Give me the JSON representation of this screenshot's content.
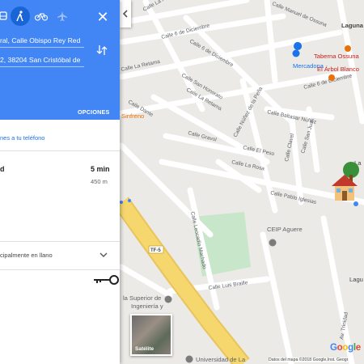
{
  "transport_modes": [
    {
      "name": "transit-mode",
      "icon": "bus-icon"
    },
    {
      "name": "walking-mode",
      "icon": "walk-icon",
      "active": true
    },
    {
      "name": "cycling-mode",
      "icon": "bicycle-icon"
    },
    {
      "name": "flight-mode",
      "icon": "plane-icon"
    }
  ],
  "close_label": "✕",
  "origin": "ral, Calle Obispo Rey Red",
  "destination": "2, 38204 San Cristóbal de",
  "options_label": "OPCIONES",
  "send_to_phone": "nes a tu teléfono",
  "route": {
    "mode_label": "d",
    "time": "5 min",
    "distance": "450 m",
    "description": "cipalmente en llano"
  },
  "map": {
    "streets": [
      "Calle La Higuera",
      "Calle Manuel de Ossuna",
      "Calle 6 de Diciembre",
      "Calle 6 de Diciembre",
      "Calle 6 de Diciembre",
      "Calle La Retama",
      "Calle San Honorato",
      "Calle La Retama",
      "Calle Dante",
      "Calle Baltasar Núñez",
      "Calle Núñez de la Peña",
      "Calle Gravol",
      "Calle El Peso",
      "Calle Clavel",
      "Calle San Juan",
      "Calle La Rosa",
      "Calle Pablo Iglesias",
      "Calle Leocadio Machado",
      "Calle Luis Braille",
      "TF-5",
      "Av. Trinidad"
    ],
    "pois": [
      "Mercadona",
      "Taberna Ossuna",
      "El Árbol Blanco",
      "Sinfreno",
      "CEIP Aguere",
      "la Superior de",
      "Ingeniería y",
      "Universidad de La"
    ],
    "edge_labels": [
      "Laguna",
      "La",
      "Lagu"
    ],
    "colors": {
      "water": "#aadaff",
      "park": "#c8e6c9",
      "road": "#ffffff",
      "highway": "#f5d76e",
      "land": "#eceae6",
      "poi_blue": "#1a73e8",
      "poi_orange": "#e8710a"
    }
  },
  "satellite_label": "Satélite",
  "attribution": "Datos del mapa ©2018 Google,Inst. Geogr",
  "google_logo": "Google"
}
